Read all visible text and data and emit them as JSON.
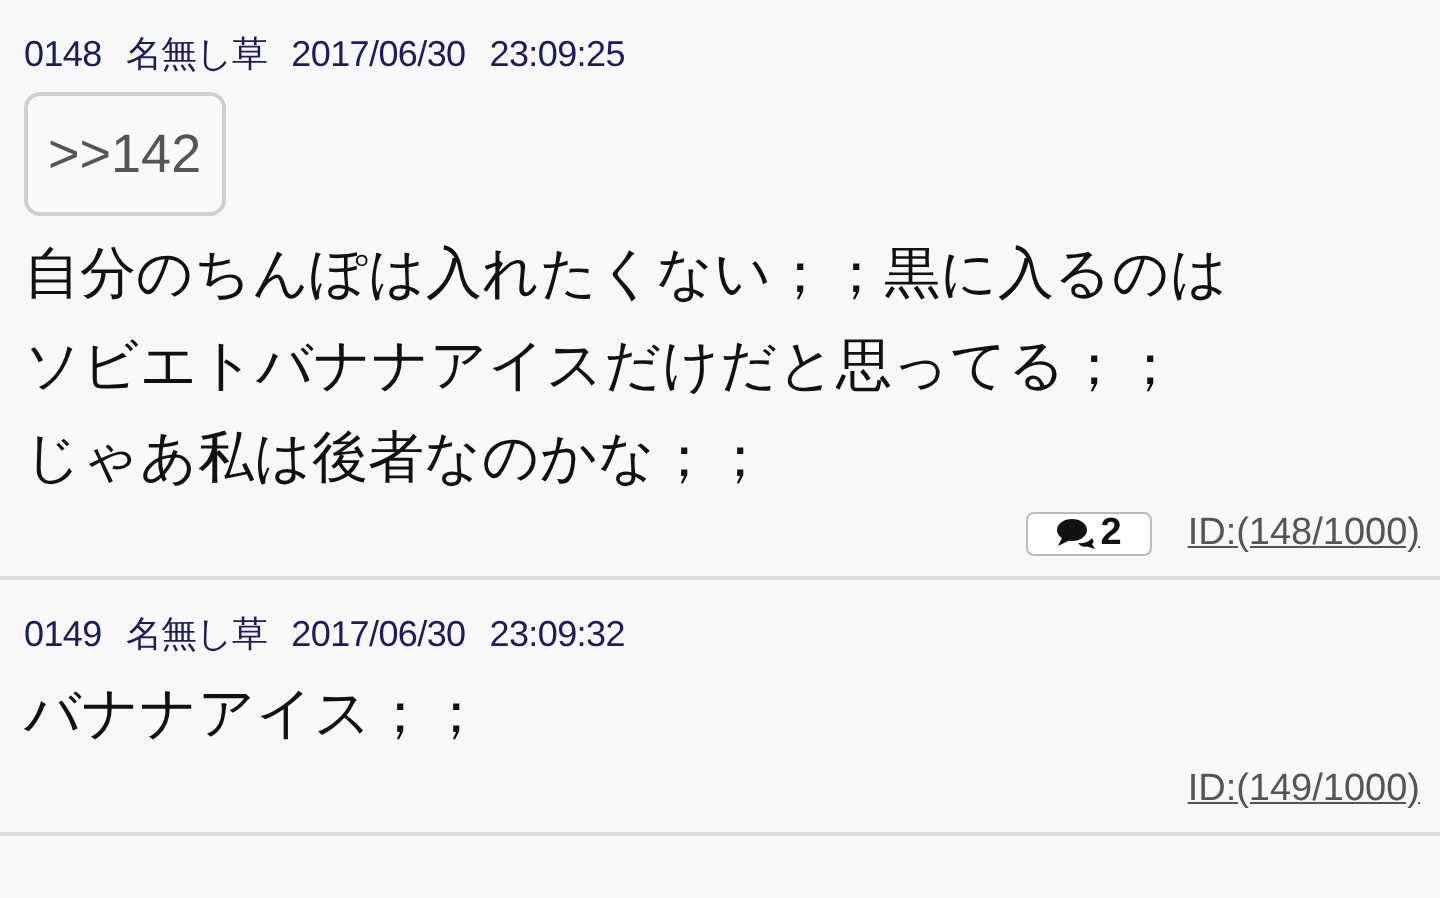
{
  "posts": [
    {
      "number": "0148",
      "name": "名無し草",
      "date": "2017/06/30",
      "time": "23:09:25",
      "anchors": [
        ">>142"
      ],
      "lines": [
        "自分のちんぽは入れたくない；；黒に入るのは",
        "ソビエトバナナアイスだけだと思ってる；；",
        "じゃあ私は後者なのかな；；"
      ],
      "replies": "2",
      "id": "ID:(148/1000)"
    },
    {
      "number": "0149",
      "name": "名無し草",
      "date": "2017/06/30",
      "time": "23:09:32",
      "lines": [
        "バナナアイス；；"
      ],
      "id": "ID:(149/1000)"
    }
  ]
}
